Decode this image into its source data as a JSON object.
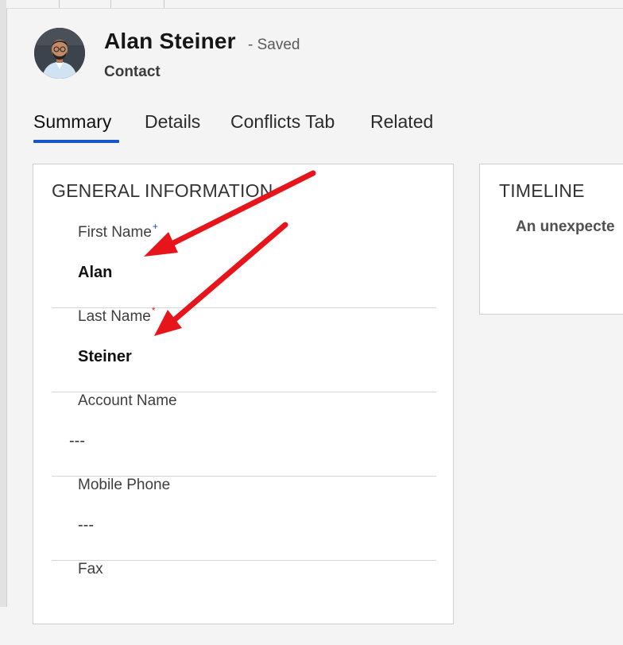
{
  "record": {
    "name": "Alan Steiner",
    "status": "- Saved",
    "entity": "Contact"
  },
  "tabs": [
    {
      "label": "Summary",
      "active": true
    },
    {
      "label": "Details",
      "active": false
    },
    {
      "label": "Conflicts Tab",
      "active": false
    },
    {
      "label": "Related",
      "active": false
    }
  ],
  "general": {
    "title": "GENERAL INFORMATION",
    "fields": [
      {
        "label": "First Name",
        "required_mark": "+",
        "required_color": "#1a40d8",
        "value": "Alan"
      },
      {
        "label": "Last Name",
        "required_mark": "*",
        "required_color": "#d62f2f",
        "value": "Steiner"
      },
      {
        "label": "Account Name",
        "value": "---"
      },
      {
        "label": "Mobile Phone",
        "value": "---"
      },
      {
        "label": "Fax",
        "value": ""
      }
    ]
  },
  "timeline": {
    "title": "TIMELINE",
    "message": "An unexpecte"
  },
  "icons": {
    "avatar": "contact-photo",
    "annotation": "red-arrow"
  },
  "colors": {
    "accent": "#1a57c6",
    "annotation": "#e8141b"
  }
}
